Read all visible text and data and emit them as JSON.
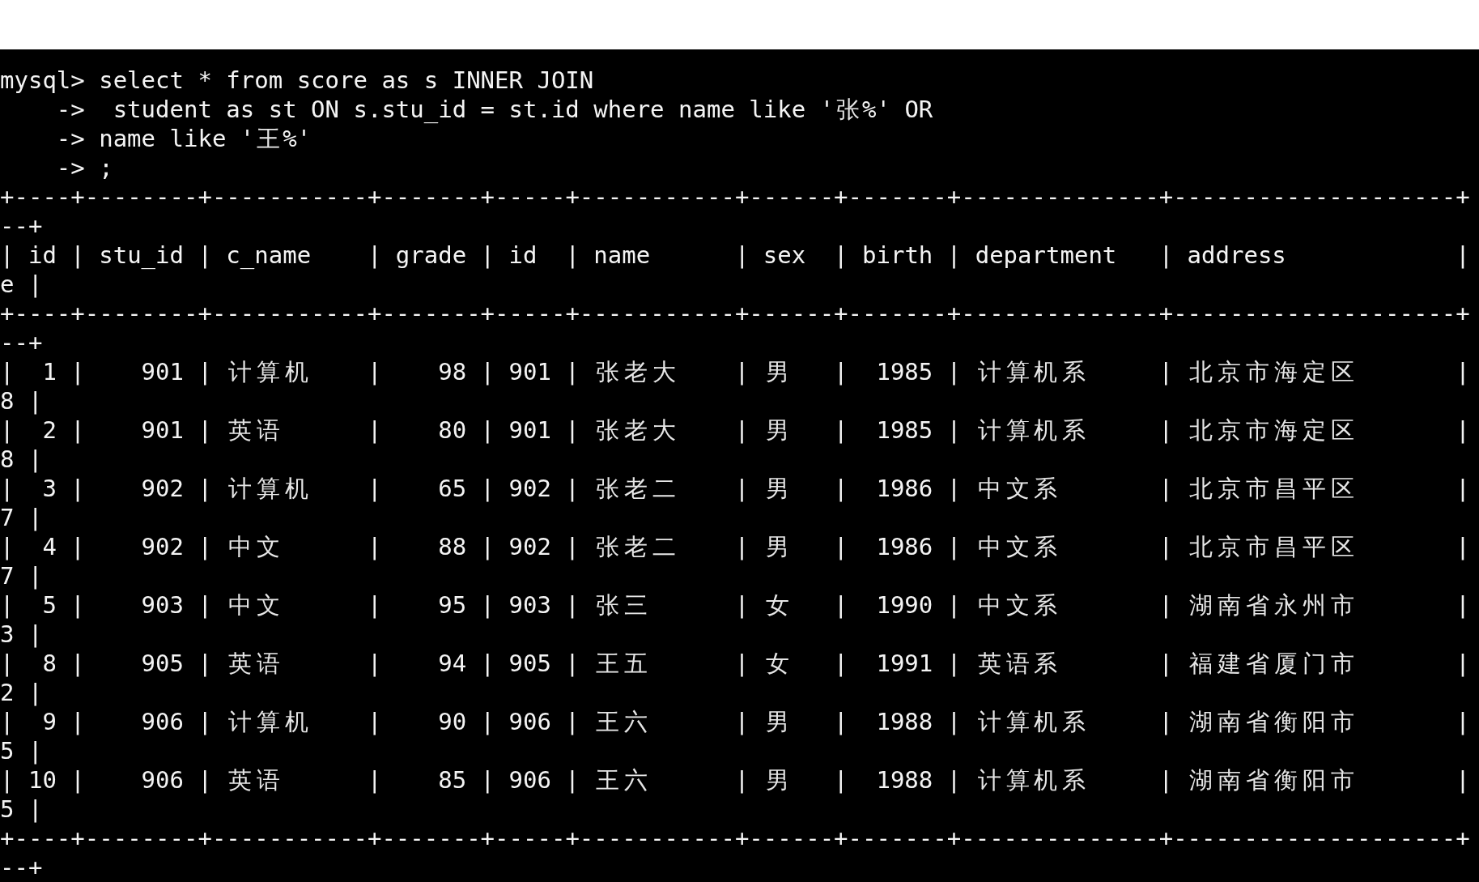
{
  "terminal": {
    "command_lines": [
      {
        "prompt": "mysql>",
        "text": "select * from score as s INNER JOIN"
      },
      {
        "prompt": "->",
        "text": " student as st ON s.stu_id = st.id where name like '张%' OR"
      },
      {
        "prompt": "->",
        "text": "name like '王%'"
      },
      {
        "prompt": "->",
        "text": ";"
      }
    ],
    "output_lines": [
      "+----+--------+-----------+-------+-----+-----------+------+-------+--------------+--------------------+",
      "--+",
      "| id | stu_id | c_name    | grade | id  | name      | sex  | birth | department   | address            |",
      "e |",
      "+----+--------+-----------+-------+-----+-----------+------+-------+--------------+--------------------+",
      "--+",
      "|  1 |    901 | 计算机    |    98 | 901 | 张老大    | 男   |  1985 | 计算机系     | 北京市海定区       |",
      "8 |",
      "|  2 |    901 | 英语      |    80 | 901 | 张老大    | 男   |  1985 | 计算机系     | 北京市海定区       |",
      "8 |",
      "|  3 |    902 | 计算机    |    65 | 902 | 张老二    | 男   |  1986 | 中文系       | 北京市昌平区       |",
      "7 |",
      "|  4 |    902 | 中文      |    88 | 902 | 张老二    | 男   |  1986 | 中文系       | 北京市昌平区       |",
      "7 |",
      "|  5 |    903 | 中文      |    95 | 903 | 张三      | 女   |  1990 | 中文系       | 湖南省永州市       |",
      "3 |",
      "|  8 |    905 | 英语      |    94 | 905 | 王五      | 女   |  1991 | 英语系       | 福建省厦门市       |",
      "2 |",
      "|  9 |    906 | 计算机    |    90 | 906 | 王六      | 男   |  1988 | 计算机系     | 湖南省衡阳市       |",
      "5 |",
      "| 10 |    906 | 英语      |    85 | 906 | 王六      | 男   |  1988 | 计算机系     | 湖南省衡阳市       |",
      "5 |",
      "+----+--------+-----------+-------+-----+-----------+------+-------+--------------+--------------------+",
      "--+"
    ]
  }
}
